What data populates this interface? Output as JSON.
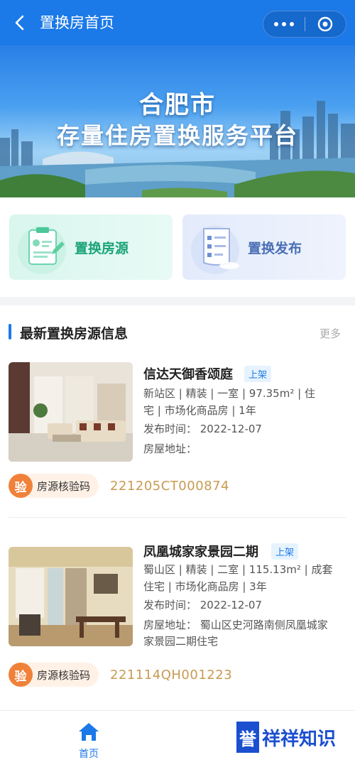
{
  "header": {
    "title": "置换房首页"
  },
  "banner": {
    "line1": "合肥市",
    "line2": "存量住房置换服务平台"
  },
  "entries": [
    {
      "label": "置换房源"
    },
    {
      "label": "置换发布"
    }
  ],
  "section": {
    "title": "最新置换房源信息",
    "more": "更多"
  },
  "listings": [
    {
      "name": "信达天御香颂庭",
      "status": "上架",
      "detail_line1": "新站区 | 精装 | 一室 | 97.35m² | 住",
      "detail_line2": "宅 | 市场化商品房 | 1年",
      "publish_time": "发布时间： 2022-12-07",
      "address": "房屋地址：",
      "address_line2": "",
      "verify_icon": "验",
      "verify_label": "房源核验码",
      "verify_code": "221205CT000874"
    },
    {
      "name": "凤凰城家家景园二期",
      "status": "上架",
      "detail_line1": "蜀山区 | 精装 | 二室 | 115.13m² | 成套",
      "detail_line2": "住宅 | 市场化商品房 | 3年",
      "publish_time": "发布时间： 2022-12-07",
      "address": "房屋地址： 蜀山区史河路南侧凤凰城家",
      "address_line2": "家景园二期住宅",
      "verify_icon": "验",
      "verify_label": "房源核验码",
      "verify_code": "221114QH001223"
    }
  ],
  "tabbar": {
    "home_label": "首页"
  },
  "watermark": {
    "boxed": "誉",
    "rest": "祥祥知识"
  },
  "colors": {
    "primary": "#1b79e8",
    "accent_orange": "#f0813a",
    "code_gold": "#c79a52",
    "green": "#1aa377"
  }
}
